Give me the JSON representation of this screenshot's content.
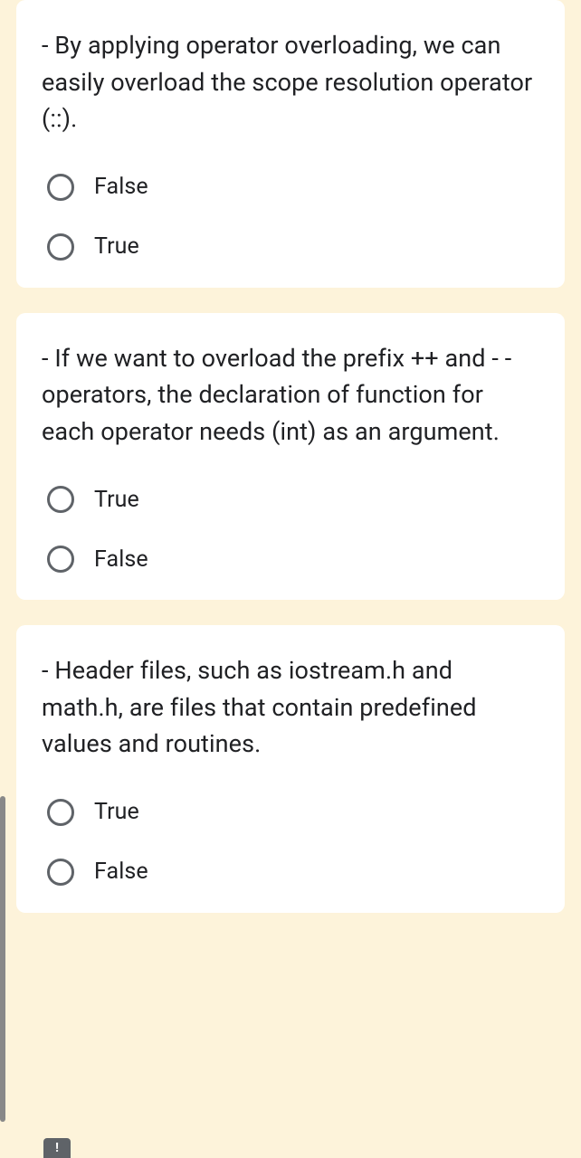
{
  "questions": [
    {
      "text": "- By applying operator overloading, we can easily overload the scope resolution operator (::).",
      "options": [
        "False",
        "True"
      ]
    },
    {
      "text": "- If we want to overload the prefix ++ and - -operators, the declaration of function for each operator needs (int) as an argument.",
      "options": [
        "True",
        "False"
      ]
    },
    {
      "text": "- Header files, such as iostream.h and math.h, are files that contain predefined values and routines.",
      "options": [
        "True",
        "False"
      ]
    }
  ],
  "badge_text": "!"
}
